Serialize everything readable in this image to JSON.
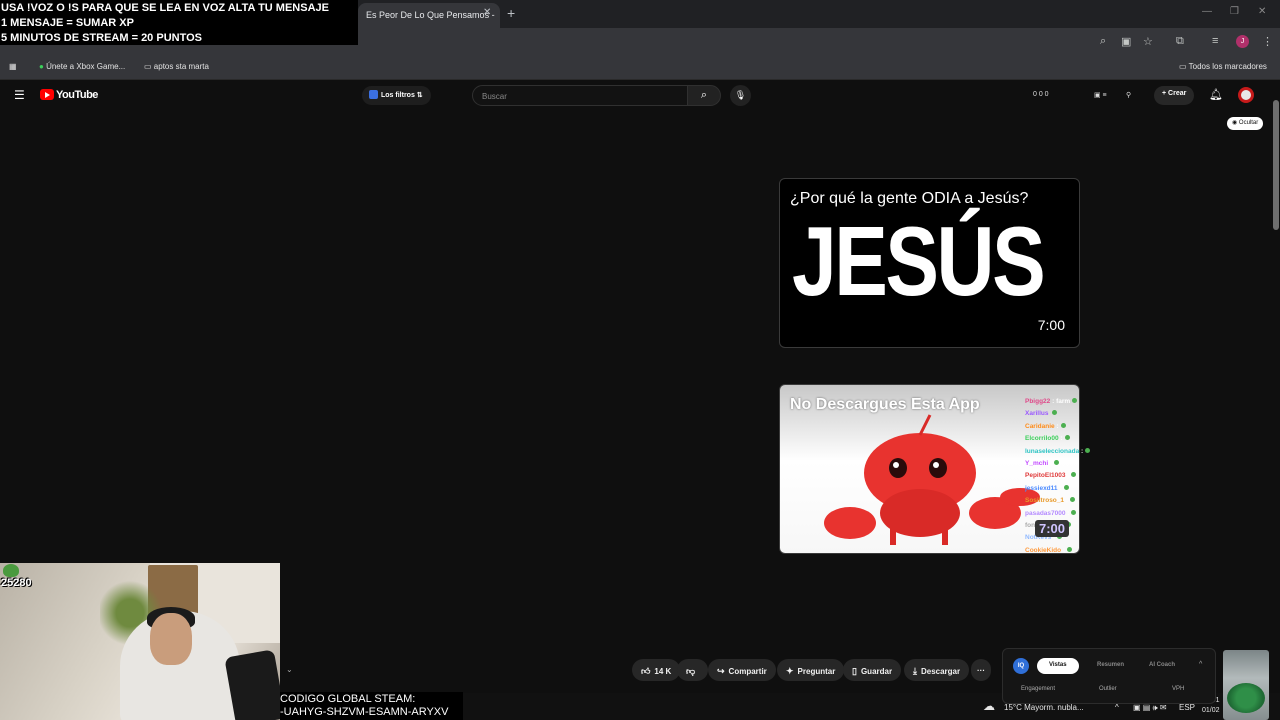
{
  "overlay": {
    "lines": [
      "USA !VOZ O !S PARA QUE SE LEA EN VOZ ALTA TU MENSAJE",
      "1 MENSAJE = SUMAR XP",
      "5 MINUTOS DE STREAM = 20 PUNTOS"
    ]
  },
  "browser": {
    "tab_title": "Es Peor De Lo Que Pensamos -",
    "bookmarks": [
      "Únete a Xbox Game...",
      "aptos sta marta",
      "Todos los marcadores"
    ],
    "profile_initial": "J"
  },
  "youtube": {
    "logo": "YouTube",
    "filters_label": "Los filtros",
    "search_placeholder": "Buscar",
    "counters": "0 0 0",
    "create_label": "Crear",
    "hide_label": "Ocultar"
  },
  "cards": [
    {
      "title": "¿Por qué la gente ODIA a Jesús?",
      "thumb_text": "JESÚS",
      "duration": "7:00"
    },
    {
      "title": "No Descargues Esta App",
      "duration": "7:00"
    }
  ],
  "chat": [
    {
      "user": "Pbigg22",
      "msg": ": farm",
      "color": "#e04a8a"
    },
    {
      "user": "Xarillus",
      "msg": "",
      "color": "#9b59ff"
    },
    {
      "user": "Caridanie",
      "msg": ":",
      "color": "#ff8c1a"
    },
    {
      "user": "Elcorrilo00",
      "msg": ":",
      "color": "#3ccf5a"
    },
    {
      "user": "lunaseleccionada",
      "msg": ":",
      "color": "#2ec4c4"
    },
    {
      "user": "Y_mchi",
      "msg": ":",
      "color": "#c24aff"
    },
    {
      "user": "PepitoEl1003",
      "msg": ":",
      "color": "#e03a3a"
    },
    {
      "user": "jessiexd11",
      "msg": ":",
      "color": "#4a8aff"
    },
    {
      "user": "Sosiltroso_1",
      "msg": ":",
      "color": "#e89a2a"
    },
    {
      "user": "pasadas7000",
      "msg": ":",
      "color": "#b48aff"
    },
    {
      "user": "fondotorito",
      "msg": ":",
      "color": "#aaaaaa"
    },
    {
      "user": "NotKevs",
      "msg": ":",
      "color": "#8fb8ff"
    },
    {
      "user": "CookieKido",
      "msg": ":",
      "color": "#ff9a3c"
    }
  ],
  "webcam": {
    "score": "25280"
  },
  "actions": {
    "likes": "14 K",
    "share": "Compartir",
    "ask": "Preguntar",
    "save": "Guardar",
    "download": "Descargar",
    "more": "···"
  },
  "code": {
    "line1": "CODIGO GLOBAL STEAM:",
    "line2": "-UAHYG-SHZVM-ESAMN-ARYXV"
  },
  "vidiq": {
    "logo": "IQ",
    "tabs": [
      "Vistas",
      "Resumen",
      "AI Coach"
    ],
    "sub": [
      "Engagement",
      "Outlier",
      "VPH"
    ]
  },
  "taskbar": {
    "weather": "15°C  Mayorm. nubla...",
    "lang": "ESP",
    "time": "09:51",
    "date": "01/02"
  }
}
